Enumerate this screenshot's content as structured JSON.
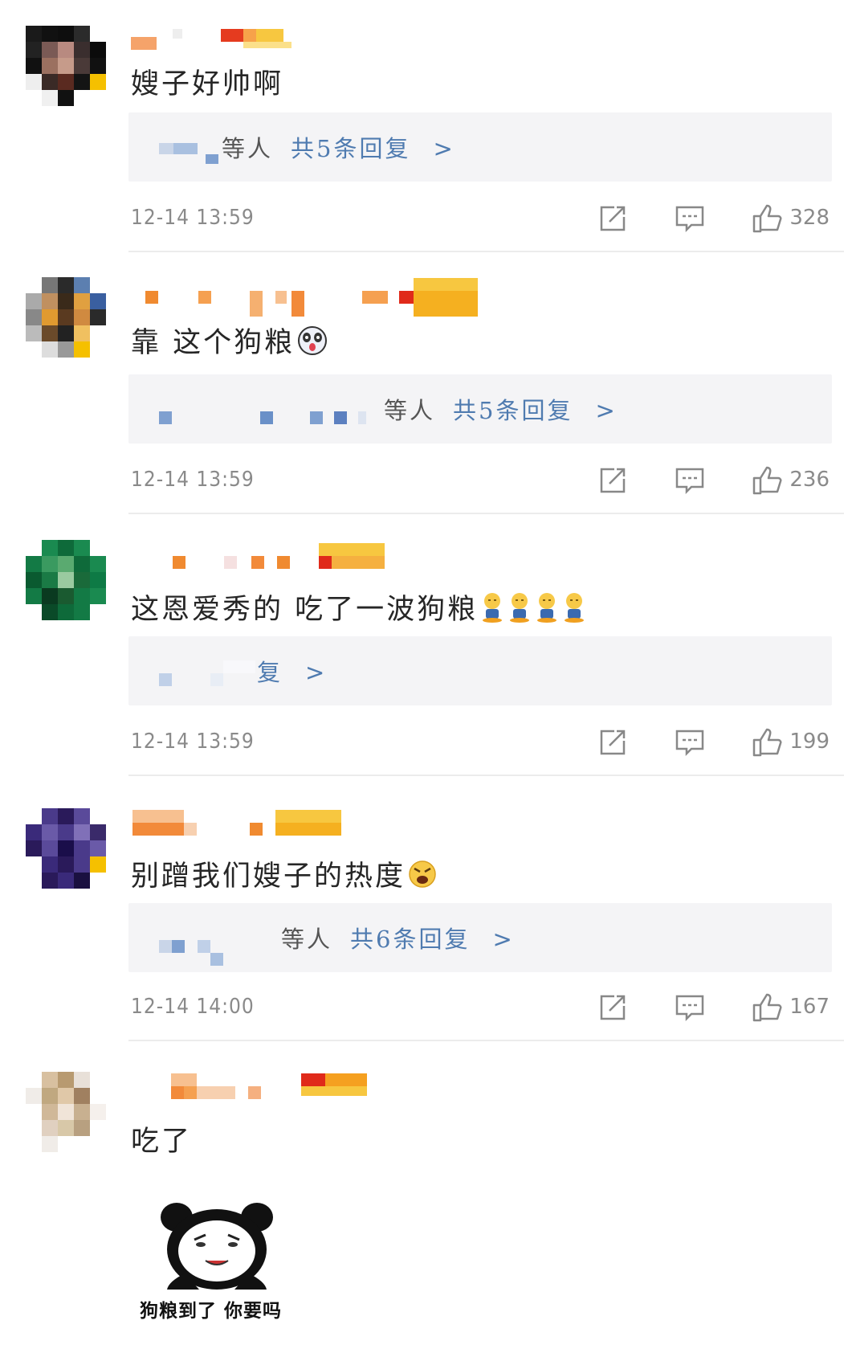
{
  "colors": {
    "link_blue": "#4f7bb0",
    "meta_gray": "#8a8a8a",
    "reply_bg": "#f4f4f6",
    "divider": "#ececec"
  },
  "comments": [
    {
      "text": "嫂子好帅啊",
      "emoji": [],
      "reply_who": "等人",
      "reply_count": "共5条回复",
      "chevron": ">",
      "time": "12-14  13:59",
      "likes": "328"
    },
    {
      "text": "靠 这个狗粮",
      "emoji": [
        "panda-face-emoji"
      ],
      "reply_who": "等人",
      "reply_count": "共5条回复",
      "chevron": ">",
      "time": "12-14  13:59",
      "likes": "236"
    },
    {
      "text": "这恩爱秀的    吃了一波狗粮",
      "emoji": [
        "eating-emoji",
        "eating-emoji",
        "eating-emoji",
        "eating-emoji"
      ],
      "reply_who": "",
      "reply_count": "复",
      "chevron": ">",
      "time": "12-14  13:59",
      "likes": "199"
    },
    {
      "text": "别蹭我们嫂子的热度",
      "emoji": [
        "angry-face-emoji"
      ],
      "reply_who": "等人",
      "reply_count": "共6条回复",
      "chevron": ">",
      "time": "12-14  14:00",
      "likes": "167"
    },
    {
      "text": "吃了",
      "emoji": [],
      "time": "",
      "likes": ""
    }
  ],
  "sticker": {
    "icon": "panda-meme-icon",
    "caption": "狗粮到了 你要吗"
  }
}
